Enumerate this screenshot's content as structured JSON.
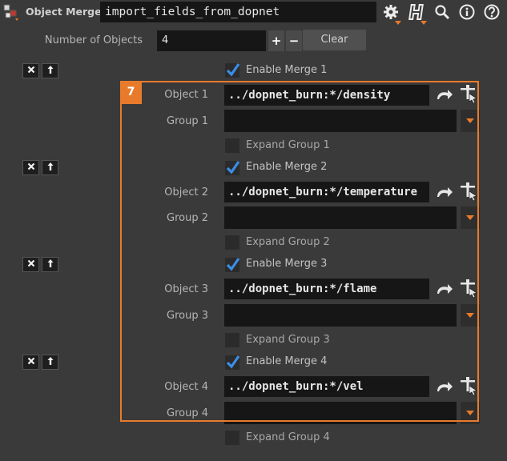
{
  "header": {
    "node_type": "Object Merge",
    "node_name": "import_fields_from_dopnet",
    "icons": [
      "gear-icon",
      "houdini-help-icon",
      "search-icon",
      "info-icon",
      "question-icon"
    ]
  },
  "num_objects": {
    "label": "Number of Objects",
    "value": "4",
    "plus": "+",
    "minus": "−",
    "clear": "Clear"
  },
  "badge": "7",
  "colors": {
    "accent": "#e87b2b",
    "check": "#3a8ee6",
    "panel": "#3a3a3a",
    "field": "#161616"
  },
  "merges": [
    {
      "enable_label": "Enable Merge 1",
      "enabled": true,
      "object_label": "Object 1",
      "object_value": "../dopnet_burn:*/density",
      "group_label": "Group 1",
      "group_value": "",
      "expand_label": "Expand Group 1",
      "expanded": false
    },
    {
      "enable_label": "Enable Merge 2",
      "enabled": true,
      "object_label": "Object 2",
      "object_value": "../dopnet_burn:*/temperature",
      "group_label": "Group 2",
      "group_value": "",
      "expand_label": "Expand Group 2",
      "expanded": false
    },
    {
      "enable_label": "Enable Merge 3",
      "enabled": true,
      "object_label": "Object 3",
      "object_value": "../dopnet_burn:*/flame",
      "group_label": "Group 3",
      "group_value": "",
      "expand_label": "Expand Group 3",
      "expanded": false
    },
    {
      "enable_label": "Enable Merge 4",
      "enabled": true,
      "object_label": "Object 4",
      "object_value": "../dopnet_burn:*/vel",
      "group_label": "Group 4",
      "group_value": "",
      "expand_label": "Expand Group 4",
      "expanded": false
    }
  ]
}
